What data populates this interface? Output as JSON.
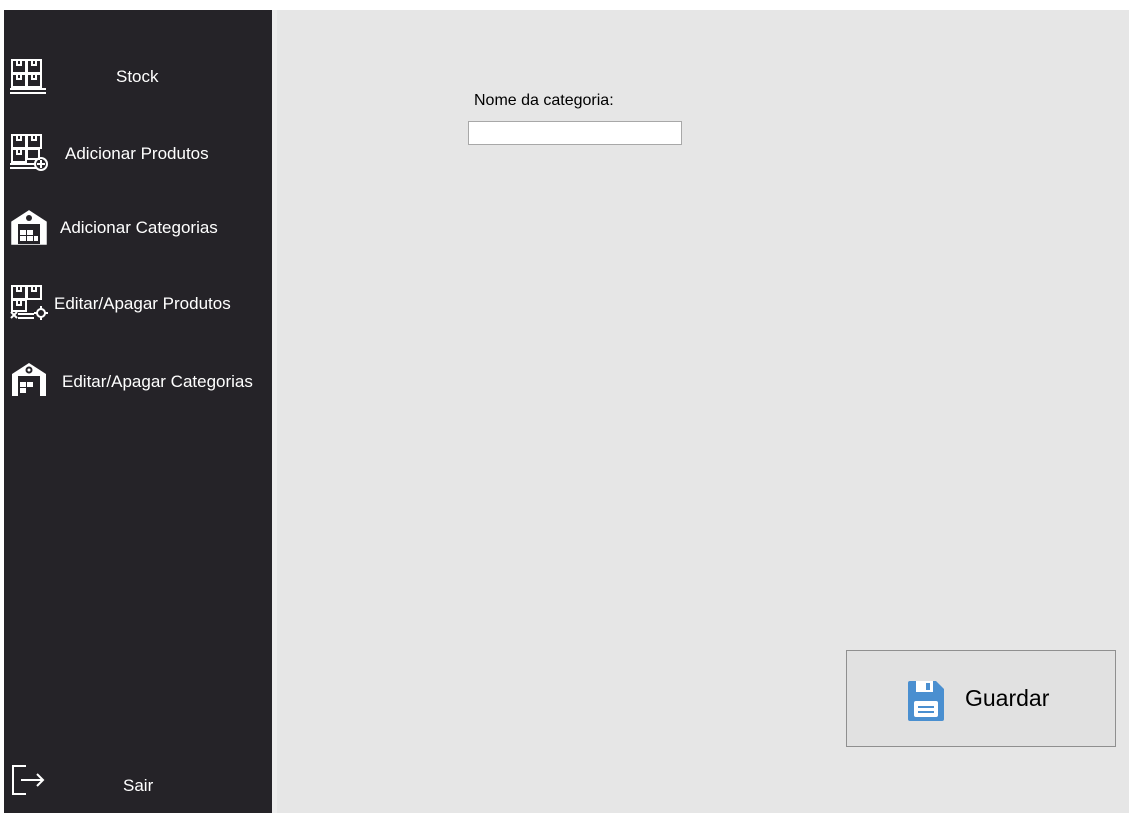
{
  "sidebar": {
    "items": [
      {
        "label": "Stock",
        "icon": "boxes-icon"
      },
      {
        "label": "Adicionar Produtos",
        "icon": "boxes-add-icon"
      },
      {
        "label": "Adicionar Categorias",
        "icon": "warehouse-icon"
      },
      {
        "label": "Editar/Apagar Produtos",
        "icon": "boxes-settings-icon"
      },
      {
        "label": "Editar/Apagar Categorias",
        "icon": "warehouse-settings-icon"
      }
    ],
    "exit": {
      "label": "Sair",
      "icon": "logout-icon"
    }
  },
  "form": {
    "category_name_label": "Nome da categoria:",
    "category_name_value": ""
  },
  "actions": {
    "save_label": "Guardar",
    "save_icon": "floppy-disk-icon",
    "save_icon_color": "#4a8fd0"
  },
  "colors": {
    "sidebar_bg": "#252328",
    "main_bg": "#e6e6e6",
    "button_bg": "#e1e1e1"
  }
}
